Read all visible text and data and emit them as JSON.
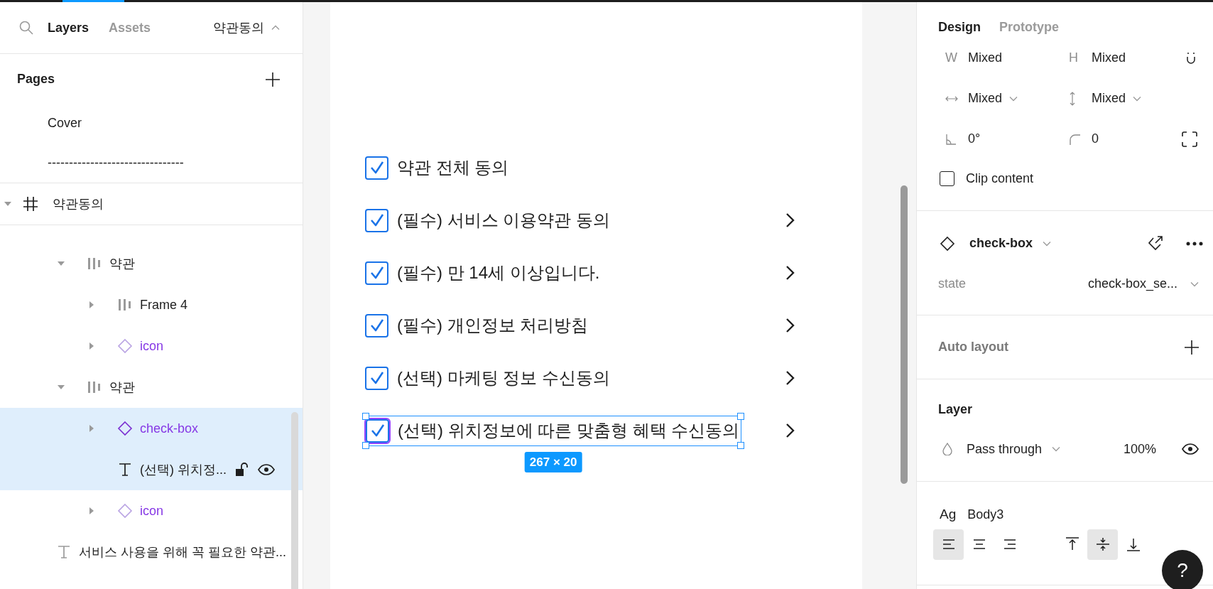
{
  "left_panel": {
    "tabs": [
      {
        "label": "Layers",
        "selected": true
      },
      {
        "label": "Assets",
        "selected": false
      }
    ],
    "page_menu": "약관동의",
    "pages": {
      "title": "Pages",
      "items": [
        {
          "label": "Cover",
          "selected": false
        },
        {
          "label": "--------------------------------",
          "selected": false
        }
      ]
    },
    "layers": {
      "name": "약관동의",
      "kind": "frame",
      "expanded": true,
      "selected": false,
      "children": [
        {
          "children": [
            {
              "name": "약관",
              "kind": "auto_layout",
              "expanded": true,
              "selected": false,
              "children": [
                {
                  "name": "Frame 4",
                  "kind": "auto_layout",
                  "expanded": false,
                  "selected": false
                },
                {
                  "name": "icon",
                  "kind": "component",
                  "expanded": false,
                  "selected": false
                }
              ]
            },
            {
              "name": "약관",
              "kind": "auto_layout",
              "expanded": true,
              "selected": false,
              "children": [
                {
                  "name": "check-box",
                  "kind": "component",
                  "expanded": false,
                  "selected": true
                },
                {
                  "name": "(선택) 위치정...",
                  "kind": "text",
                  "selected": true,
                  "locked": false,
                  "visible": true
                },
                {
                  "name": "icon",
                  "kind": "component",
                  "expanded": false,
                  "selected": false
                }
              ]
            }
          ]
        },
        {
          "name": "서비스 사용을 위해 꼭 필요한 약관...",
          "kind": "text",
          "selected": false
        }
      ]
    }
  },
  "canvas": {
    "items": [
      {
        "label": "약관 전체 동의",
        "checked": true,
        "chevron": false,
        "selected": false
      },
      {
        "label": "(필수) 서비스 이용약관 동의",
        "checked": true,
        "chevron": true,
        "selected": false
      },
      {
        "label": "(필수) 만 14세 이상입니다.",
        "checked": true,
        "chevron": true,
        "selected": false
      },
      {
        "label": "(필수) 개인정보 처리방침",
        "checked": true,
        "chevron": true,
        "selected": false
      },
      {
        "label": "(선택) 마케팅 정보 수신동의",
        "checked": true,
        "chevron": true,
        "selected": false
      },
      {
        "label": "(선택) 위치정보에 따른 맞춤형 혜택 수신동의",
        "checked": true,
        "chevron": true,
        "selected": true
      }
    ],
    "selection_size": "267 × 20"
  },
  "right_panel": {
    "tabs": [
      {
        "label": "Design",
        "selected": true
      },
      {
        "label": "Prototype",
        "selected": false
      }
    ],
    "fields": [
      {
        "label": "W",
        "value": "Mixed",
        "dropdown": false
      },
      {
        "label": "H",
        "value": "Mixed",
        "dropdown": false
      },
      {
        "kind": "hresize",
        "value": "Mixed",
        "dropdown": true
      },
      {
        "kind": "vresize",
        "value": "Mixed",
        "dropdown": true
      },
      {
        "kind": "rotation",
        "value": "0°",
        "dropdown": false
      },
      {
        "kind": "radius",
        "value": "0",
        "dropdown": false
      }
    ],
    "clip_content": {
      "label": "Clip content",
      "checked": false
    },
    "component": {
      "name": "check-box",
      "properties": [
        {
          "label": "state",
          "value": "check-box_se..."
        }
      ]
    },
    "auto_layout": {
      "title": "Auto layout"
    },
    "layer": {
      "title": "Layer",
      "blend": "Pass through",
      "opacity": "100%",
      "visible": true
    },
    "text": {
      "sample": "Ag",
      "style": "Body3",
      "align": [
        {
          "kind": "left",
          "selected": true
        },
        {
          "kind": "center",
          "selected": false
        },
        {
          "kind": "right",
          "selected": false
        }
      ],
      "vertical_align": [
        {
          "kind": "top",
          "selected": false
        },
        {
          "kind": "middle",
          "selected": true
        },
        {
          "kind": "bottom",
          "selected": false
        }
      ]
    }
  },
  "help": "?"
}
